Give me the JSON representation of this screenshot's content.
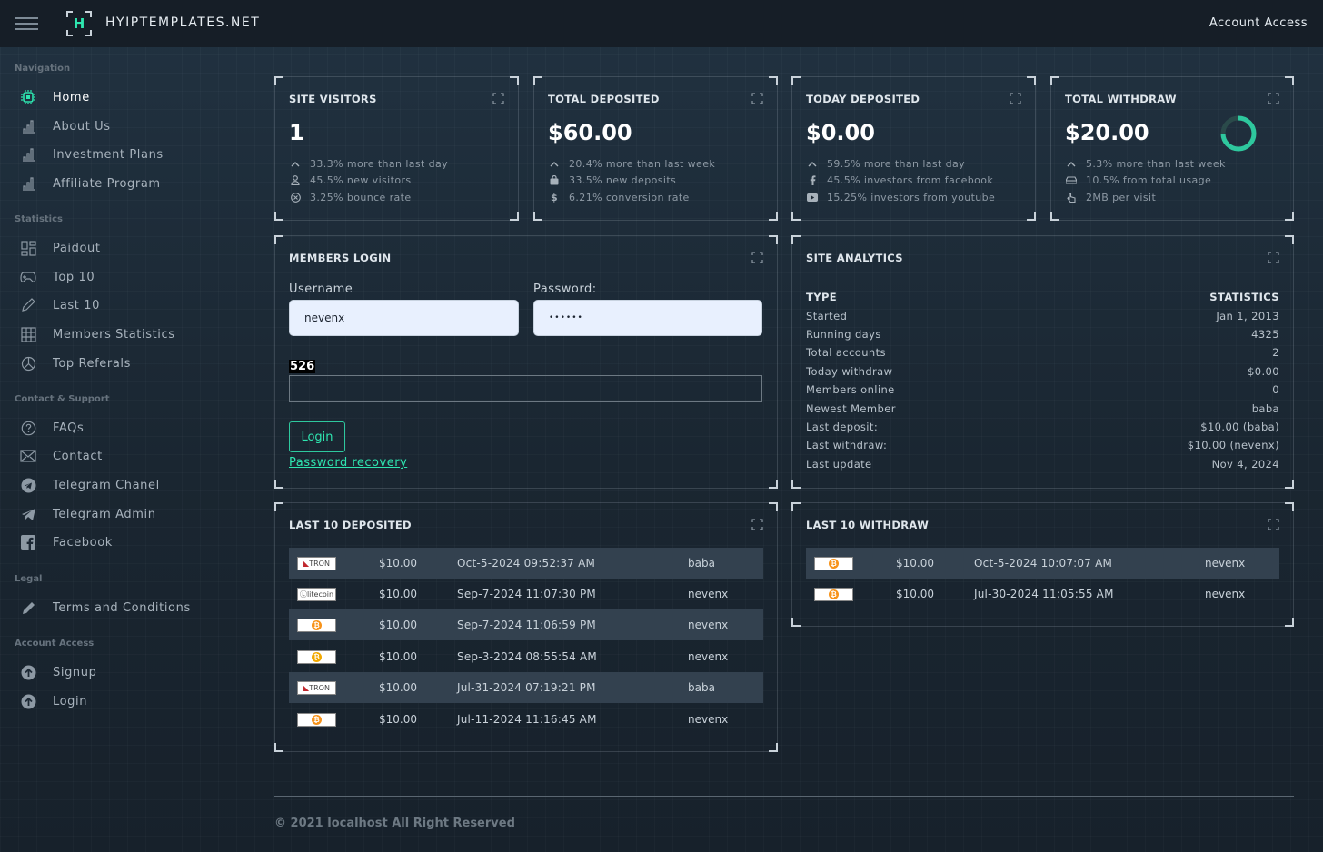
{
  "topbar": {
    "brand": "HYIPTEMPLATES.NET",
    "logo_letter": "H",
    "account_access": "Account Access"
  },
  "sidebar": {
    "sections": [
      "Navigation",
      "Statistics",
      "Contact & Support",
      "Legal",
      "Account Access"
    ],
    "navigation": [
      {
        "label": "Home",
        "icon": "chip-icon"
      },
      {
        "label": "About Us",
        "icon": "bar-chart-icon"
      },
      {
        "label": "Investment Plans",
        "icon": "bar-chart-icon"
      },
      {
        "label": "Affiliate Program",
        "icon": "bar-chart-icon"
      }
    ],
    "statistics": [
      {
        "label": "Paidout",
        "icon": "dashboard-icon"
      },
      {
        "label": "Top 10",
        "icon": "gamepad-icon"
      },
      {
        "label": "Last 10",
        "icon": "pencil-icon"
      },
      {
        "label": "Members Statistics",
        "icon": "grid-icon"
      },
      {
        "label": "Top Referals",
        "icon": "pie-icon"
      }
    ],
    "contact": [
      {
        "label": "FAQs",
        "icon": "question-icon"
      },
      {
        "label": "Contact",
        "icon": "envelope-icon"
      },
      {
        "label": "Telegram Chanel",
        "icon": "telegram-icon"
      },
      {
        "label": "Telegram Admin",
        "icon": "send-icon"
      },
      {
        "label": "Facebook",
        "icon": "facebook-icon"
      }
    ],
    "legal": [
      {
        "label": "Terms and Conditions",
        "icon": "pen-icon"
      }
    ],
    "account": [
      {
        "label": "Signup",
        "icon": "arrow-up-circle-icon"
      },
      {
        "label": "Login",
        "icon": "arrow-up-circle-icon"
      }
    ]
  },
  "stats": [
    {
      "title": "SITE VISITORS",
      "value": "1",
      "lines": [
        "33.3% more than last day",
        "45.5% new visitors",
        "3.25% bounce rate"
      ],
      "icons": [
        "chevron-up-icon",
        "user-icon",
        "x-circle-icon"
      ]
    },
    {
      "title": "TOTAL DEPOSITED",
      "value": "$60.00",
      "lines": [
        "20.4% more than last week",
        "33.5% new deposits",
        "6.21% conversion rate"
      ],
      "icons": [
        "chevron-up-icon",
        "bag-icon",
        "dollar-icon"
      ]
    },
    {
      "title": "TODAY DEPOSITED",
      "value": "$0.00",
      "lines": [
        "59.5% more than last day",
        "45.5% investors from facebook",
        "15.25% investors from youtube"
      ],
      "icons": [
        "chevron-up-icon",
        "facebook-icon",
        "youtube-icon"
      ]
    },
    {
      "title": "TOTAL WITHDRAW",
      "value": "$20.00",
      "lines": [
        "5.3% more than last week",
        "10.5% from total usage",
        "2MB per visit"
      ],
      "icons": [
        "chevron-up-icon",
        "drive-icon",
        "pointer-icon"
      ]
    }
  ],
  "login": {
    "title": "MEMBERS LOGIN",
    "username_label": "Username",
    "username_value": "nevenx",
    "password_label": "Password:",
    "password_value": "••••••",
    "captcha": "526",
    "button": "Login",
    "recovery": "Password recovery"
  },
  "analytics": {
    "title": "SITE ANALYTICS",
    "head_type": "TYPE",
    "head_stats": "STATISTICS",
    "rows": [
      {
        "k": "Started",
        "v": "Jan 1, 2013"
      },
      {
        "k": "Running days",
        "v": "4325"
      },
      {
        "k": "Total accounts",
        "v": "2"
      },
      {
        "k": "Today withdraw",
        "v": "$0.00"
      },
      {
        "k": "Members online",
        "v": "0"
      },
      {
        "k": "Newest Member",
        "v": "baba"
      },
      {
        "k": "Last deposit:",
        "v": "$10.00 (baba)"
      },
      {
        "k": "Last withdraw:",
        "v": "$10.00 (nevenx)"
      },
      {
        "k": "Last update",
        "v": "Nov 4, 2024"
      }
    ]
  },
  "deposits": {
    "title": "LAST 10 DEPOSITED",
    "rows": [
      {
        "coin": "TRON",
        "amount": "$10.00",
        "date": "Oct-5-2024 09:52:37 AM",
        "user": "baba"
      },
      {
        "coin": "litecoin",
        "amount": "$10.00",
        "date": "Sep-7-2024 11:07:30 PM",
        "user": "nevenx"
      },
      {
        "coin": "BTC",
        "amount": "$10.00",
        "date": "Sep-7-2024 11:06:59 PM",
        "user": "nevenx"
      },
      {
        "coin": "BTC",
        "amount": "$10.00",
        "date": "Sep-3-2024 08:55:54 AM",
        "user": "nevenx"
      },
      {
        "coin": "TRON",
        "amount": "$10.00",
        "date": "Jul-31-2024 07:19:21 PM",
        "user": "baba"
      },
      {
        "coin": "BTC",
        "amount": "$10.00",
        "date": "Jul-11-2024 11:16:45 AM",
        "user": "nevenx"
      }
    ]
  },
  "withdraws": {
    "title": "LAST 10 WITHDRAW",
    "rows": [
      {
        "coin": "BTC",
        "amount": "$10.00",
        "date": "Oct-5-2024 10:07:07 AM",
        "user": "nevenx"
      },
      {
        "coin": "BTC",
        "amount": "$10.00",
        "date": "Jul-30-2024 11:05:55 AM",
        "user": "nevenx"
      }
    ]
  },
  "footer": "© 2021 localhost All Right Reserved",
  "colors": {
    "accent": "#2ee6b0",
    "row_alt": "#33414f",
    "topbar": "#161e27"
  }
}
